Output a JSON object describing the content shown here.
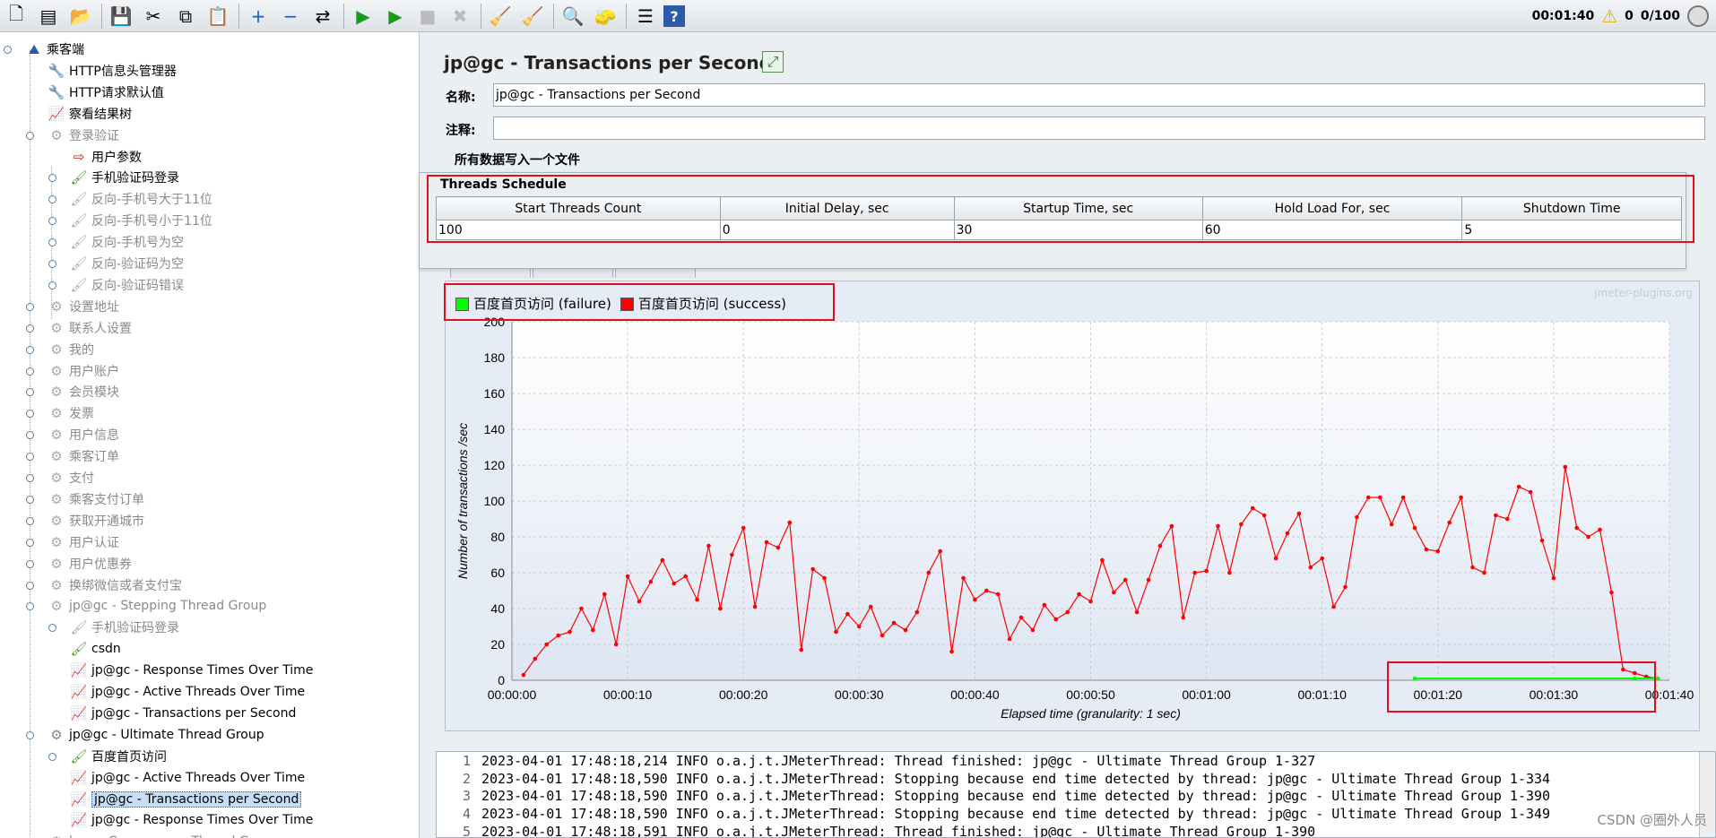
{
  "toolbar": {
    "icons": [
      "new-icon",
      "templates-icon",
      "open-icon",
      "save-icon",
      "cut-icon",
      "copy-icon",
      "paste-icon",
      "expand-icon",
      "collapse-icon",
      "toggle-icon",
      "start-icon",
      "start-no-pause-icon",
      "stop-icon",
      "shutdown-icon",
      "clear-icon",
      "clear-all-icon",
      "search-icon",
      "reset-search-icon",
      "function-helper-icon",
      "help-icon"
    ],
    "timer": "00:01:40",
    "warnings": "0",
    "threads": "0/100"
  },
  "tree": [
    {
      "label": "乘客端",
      "level": 0,
      "icon": "testplan-icon",
      "disabled": false
    },
    {
      "label": "HTTP信息头管理器",
      "level": 1,
      "icon": "wrench-icon",
      "disabled": false
    },
    {
      "label": "HTTP请求默认值",
      "level": 1,
      "icon": "wrench-icon",
      "disabled": false
    },
    {
      "label": "察看结果树",
      "level": 1,
      "icon": "listener-icon",
      "disabled": false
    },
    {
      "label": "登录验证",
      "level": 1,
      "icon": "gear-icon",
      "disabled": true
    },
    {
      "label": "用户参数",
      "level": 2,
      "icon": "preprocessor-icon",
      "disabled": false
    },
    {
      "label": "手机验证码登录",
      "level": 2,
      "icon": "sampler-icon",
      "disabled": false
    },
    {
      "label": "反向-手机号大于11位",
      "level": 2,
      "icon": "sampler-icon",
      "disabled": true
    },
    {
      "label": "反向-手机号小于11位",
      "level": 2,
      "icon": "sampler-icon",
      "disabled": true
    },
    {
      "label": "反向-手机号为空",
      "level": 2,
      "icon": "sampler-icon",
      "disabled": true
    },
    {
      "label": "反向-验证码为空",
      "level": 2,
      "icon": "sampler-icon",
      "disabled": true
    },
    {
      "label": "反向-验证码错误",
      "level": 2,
      "icon": "sampler-icon",
      "disabled": true
    },
    {
      "label": "设置地址",
      "level": 1,
      "icon": "gear-icon",
      "disabled": true
    },
    {
      "label": "联系人设置",
      "level": 1,
      "icon": "gear-icon",
      "disabled": true
    },
    {
      "label": "我的",
      "level": 1,
      "icon": "gear-icon",
      "disabled": true
    },
    {
      "label": "用户账户",
      "level": 1,
      "icon": "gear-icon",
      "disabled": true
    },
    {
      "label": "会员模块",
      "level": 1,
      "icon": "gear-icon",
      "disabled": true
    },
    {
      "label": "发票",
      "level": 1,
      "icon": "gear-icon",
      "disabled": true
    },
    {
      "label": "用户信息",
      "level": 1,
      "icon": "gear-icon",
      "disabled": true
    },
    {
      "label": "乘客订单",
      "level": 1,
      "icon": "gear-icon",
      "disabled": true
    },
    {
      "label": "支付",
      "level": 1,
      "icon": "gear-icon",
      "disabled": true
    },
    {
      "label": "乘客支付订单",
      "level": 1,
      "icon": "gear-icon",
      "disabled": true
    },
    {
      "label": "获取开通城市",
      "level": 1,
      "icon": "gear-icon",
      "disabled": true
    },
    {
      "label": "用户认证",
      "level": 1,
      "icon": "gear-icon",
      "disabled": true
    },
    {
      "label": "用户优惠券",
      "level": 1,
      "icon": "gear-icon",
      "disabled": true
    },
    {
      "label": "换绑微信或者支付宝",
      "level": 1,
      "icon": "gear-icon",
      "disabled": true
    },
    {
      "label": "jp@gc - Stepping Thread Group",
      "level": 1,
      "icon": "gear-icon",
      "disabled": true
    },
    {
      "label": "手机验证码登录",
      "level": 2,
      "icon": "sampler-icon",
      "disabled": true
    },
    {
      "label": "csdn",
      "level": 2,
      "icon": "sampler-icon",
      "disabled": false
    },
    {
      "label": "jp@gc - Response Times Over Time",
      "level": 2,
      "icon": "listener-icon",
      "disabled": false
    },
    {
      "label": "jp@gc - Active Threads Over Time",
      "level": 2,
      "icon": "listener-icon",
      "disabled": false
    },
    {
      "label": "jp@gc - Transactions per Second",
      "level": 2,
      "icon": "listener-icon",
      "disabled": false
    },
    {
      "label": "jp@gc - Ultimate Thread Group",
      "level": 1,
      "icon": "gear-icon",
      "disabled": false
    },
    {
      "label": "百度首页访问",
      "level": 2,
      "icon": "sampler-icon",
      "disabled": false
    },
    {
      "label": "jp@gc - Active Threads Over Time",
      "level": 2,
      "icon": "listener-icon",
      "disabled": false
    },
    {
      "label": "jp@gc - Transactions per Second",
      "level": 2,
      "icon": "listener-icon",
      "disabled": false,
      "selected": true
    },
    {
      "label": "jp@gc - Response Times Over Time",
      "level": 2,
      "icon": "listener-icon",
      "disabled": false
    },
    {
      "label": "bzm - Concurrency Thread Group",
      "level": 1,
      "icon": "gear-icon",
      "disabled": true
    }
  ],
  "panel": {
    "title": "jp@gc - Transactions per Second",
    "name_label": "名称:",
    "name_value": "jp@gc - Transactions per Second",
    "comment_label": "注释:",
    "comment_value": "",
    "file_section": "所有数据写入一个文件"
  },
  "threads_schedule": {
    "title": "Threads Schedule",
    "columns": [
      "Start Threads Count",
      "Initial Delay, sec",
      "Startup Time, sec",
      "Hold Load For, sec",
      "Shutdown Time"
    ],
    "rows": [
      [
        "100",
        "0",
        "30",
        "60",
        "5"
      ]
    ]
  },
  "watermark": "jmeter-plugins.org",
  "chart_data": {
    "type": "line",
    "xlabel": "Elapsed time (granularity: 1 sec)",
    "ylabel": "Number of transactions /sec",
    "ylim": [
      0,
      200
    ],
    "xlim": [
      0,
      100
    ],
    "yticks": [
      "0",
      "20",
      "40",
      "60",
      "80",
      "100",
      "120",
      "140",
      "160",
      "180",
      "200"
    ],
    "xticks": [
      "00:00:00",
      "00:00:10",
      "00:00:20",
      "00:00:30",
      "00:00:40",
      "00:00:50",
      "00:01:00",
      "00:01:10",
      "00:01:20",
      "00:01:30",
      "00:01:40"
    ],
    "legend_position": "top-left",
    "series": [
      {
        "name": "百度首页访问 (failure)",
        "color": "#00ff00",
        "x": [
          78,
          97,
          99
        ],
        "y": [
          1,
          1,
          1
        ]
      },
      {
        "name": "百度首页访问 (success)",
        "color": "#ff0000",
        "x": [
          1,
          2,
          3,
          4,
          5,
          6,
          7,
          8,
          9,
          10,
          11,
          12,
          13,
          14,
          15,
          16,
          17,
          18,
          19,
          20,
          21,
          22,
          23,
          24,
          25,
          26,
          27,
          28,
          29,
          30,
          31,
          32,
          33,
          34,
          35,
          36,
          37,
          38,
          39,
          40,
          41,
          42,
          43,
          44,
          45,
          46,
          47,
          48,
          49,
          50,
          51,
          52,
          53,
          54,
          55,
          56,
          57,
          58,
          59,
          60,
          61,
          62,
          63,
          64,
          65,
          66,
          67,
          68,
          69,
          70,
          71,
          72,
          73,
          74,
          75,
          76,
          77,
          78,
          79,
          80,
          81,
          82,
          83,
          84,
          85,
          86,
          87,
          88,
          89,
          90,
          91,
          92,
          93,
          94,
          95,
          96,
          97,
          98,
          99
        ],
        "y": [
          3,
          12,
          20,
          25,
          27,
          40,
          28,
          48,
          20,
          58,
          44,
          55,
          67,
          54,
          58,
          45,
          75,
          40,
          70,
          85,
          41,
          77,
          74,
          88,
          17,
          62,
          57,
          27,
          37,
          30,
          41,
          25,
          32,
          28,
          38,
          60,
          72,
          16,
          57,
          45,
          50,
          48,
          23,
          35,
          28,
          42,
          34,
          38,
          48,
          44,
          67,
          49,
          56,
          38,
          56,
          75,
          86,
          35,
          60,
          61,
          86,
          60,
          87,
          96,
          92,
          68,
          82,
          93,
          63,
          68,
          41,
          52,
          91,
          102,
          102,
          87,
          102,
          85,
          73,
          72,
          88,
          102,
          63,
          60,
          92,
          90,
          108,
          105,
          78,
          57,
          119,
          85,
          80,
          84,
          49,
          6,
          4,
          2,
          1
        ]
      }
    ]
  },
  "log": [
    {
      "n": "1",
      "text": "2023-04-01 17:48:18,214 INFO o.a.j.t.JMeterThread: Thread finished: jp@gc - Ultimate Thread Group 1-327"
    },
    {
      "n": "2",
      "text": "2023-04-01 17:48:18,590 INFO o.a.j.t.JMeterThread: Stopping because end time detected by thread: jp@gc - Ultimate Thread Group 1-334"
    },
    {
      "n": "3",
      "text": "2023-04-01 17:48:18,590 INFO o.a.j.t.JMeterThread: Stopping because end time detected by thread: jp@gc - Ultimate Thread Group 1-390"
    },
    {
      "n": "4",
      "text": "2023-04-01 17:48:18,590 INFO o.a.j.t.JMeterThread: Stopping because end time detected by thread: jp@gc - Ultimate Thread Group 1-349"
    },
    {
      "n": "5",
      "text": "2023-04-01 17:48:18,591 INFO o.a.j.t.JMeterThread: Thread finished: jp@gc - Ultimate Thread Group 1-390"
    }
  ],
  "csdn_watermark": "CSDN @圈外人员"
}
